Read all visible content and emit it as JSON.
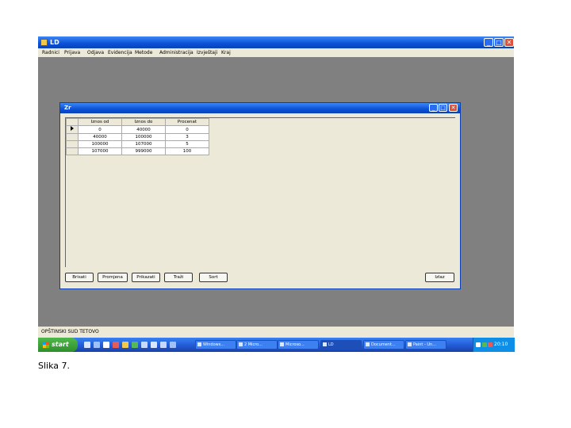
{
  "window": {
    "title": "LD",
    "minimize": "_",
    "maximize": "□",
    "close": "✕"
  },
  "menu": [
    "Radnici",
    "Prijava",
    "Odjava",
    "Evidencija",
    "Metode",
    "Administracija",
    "Izvještaji",
    "Kraj"
  ],
  "status": {
    "text": "OPŠTINSKI SUD TETOVO"
  },
  "dialog": {
    "title": "Zr",
    "minimize": "_",
    "maximize": "□",
    "close": "✕",
    "columns": [
      "Iznos od",
      "Iznos do",
      "Procenat"
    ],
    "rows": [
      [
        "0",
        "40000",
        "0"
      ],
      [
        "40000",
        "100000",
        "3"
      ],
      [
        "100000",
        "107000",
        "5"
      ],
      [
        "107000",
        "999000",
        "100"
      ]
    ],
    "buttons": [
      "Brisati",
      "Promjena",
      "Prikazati",
      "Traži",
      "Sort"
    ],
    "close_button": "Izlaz"
  },
  "taskbar": {
    "start": "start",
    "tasks": [
      "Windows...",
      "2 Micro...",
      "Microso...",
      "LD",
      "Document...",
      "Paint - Un..."
    ],
    "active_task": "LD",
    "tray_lang": "EN",
    "clock": "20:10",
    "colors": {
      "taskbar": "#245edb",
      "start": "#2f8f2c"
    }
  },
  "caption": "Slika 7."
}
